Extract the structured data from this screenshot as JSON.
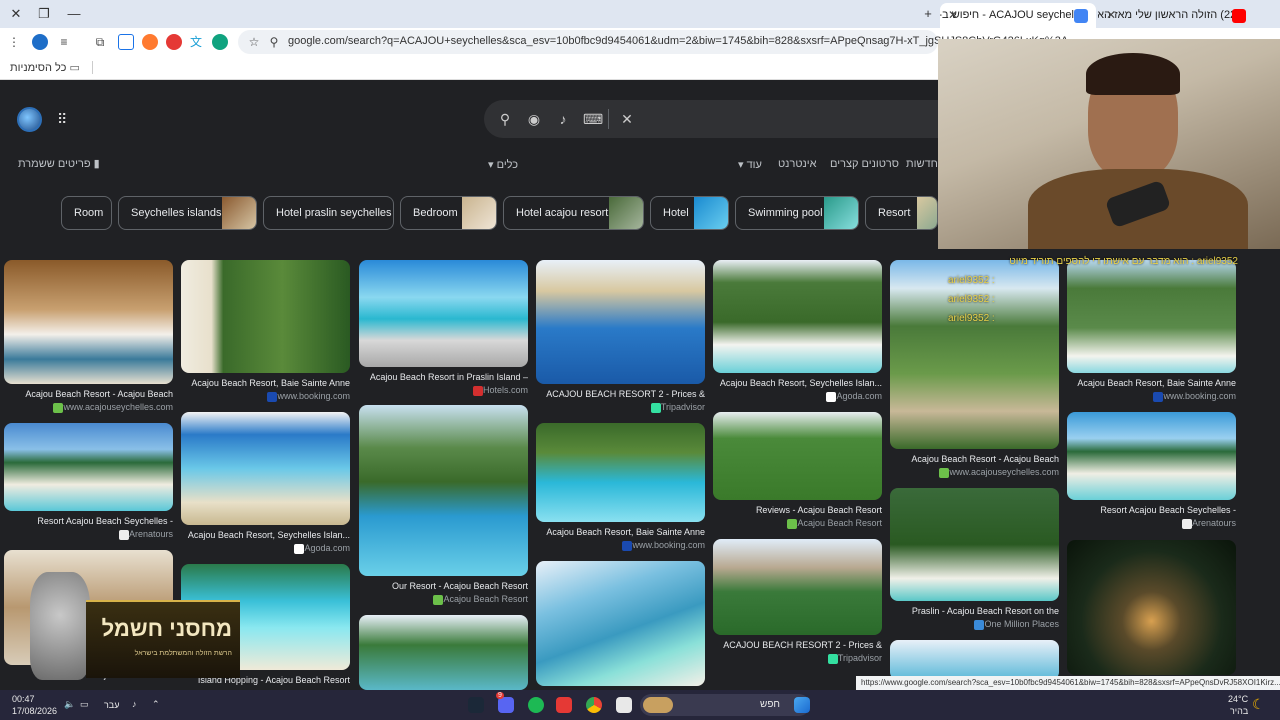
{
  "browser": {
    "tabs": [
      {
        "title": "ACAJOU seychelles - חיפוש ב-Google",
        "active": true
      },
      {
        "title": "(229) הזולה הראשון שלי מאז הא...",
        "active": false
      }
    ],
    "url": "google.com/search?q=ACAJOU+seychelles&sca_esv=10b0fbc9d9454061&udm=2&biw=1745&bih=828&sxsrf=APpeQnsag7H-xT_jgSUJS8CbVrG426LxKg%3A",
    "bookmarks_label": "כל הסימניות",
    "status_url": "https://www.google.com/search?sca_esv=10b0fbc9d9454061&biw=1745&bih=828&sxsrf=APpeQnsDvRJ58XOI1Kirz..."
  },
  "search": {
    "tools_left": "כלים",
    "saved_label": "פריטים ששמרת",
    "tools": [
      "חדשות",
      "סרטונים קצרים",
      "אינטרנט",
      "עוד"
    ]
  },
  "chips": [
    {
      "label": "Room"
    },
    {
      "label": "Seychelles islands"
    },
    {
      "label": "Hotel praslin seychelles"
    },
    {
      "label": "Bedroom"
    },
    {
      "label": "Hotel acajou resort"
    },
    {
      "label": "Hotel"
    },
    {
      "label": "Swimming pool"
    },
    {
      "label": "Resort"
    }
  ],
  "results": [
    {
      "caption": "Acajou Beach Resort - Acajou Beach",
      "source": "www.acajouseychelles.com"
    },
    {
      "caption": "Resort Acajou Beach Seychelles -",
      "source": "Arenatours"
    },
    {
      "caption": "Acajou Beach Resort",
      "source": "Hotels.com"
    },
    {
      "caption": "Acajou Beach Resort, Baie Sainte Anne",
      "source": "www.booking.com"
    },
    {
      "caption": "Acajou Beach Resort, Seychelles Islan...",
      "source": "Agoda.com"
    },
    {
      "caption": "Island Hopping - Acajou Beach Resort",
      "source": ""
    },
    {
      "caption": "Acajou Beach Resort in Praslin Island –",
      "source": "Hotels.com"
    },
    {
      "caption": "Our Resort - Acajou Beach Resort",
      "source": "Acajou Beach Resort"
    },
    {
      "caption": "ACAJOU BEACH RESORT 2 - Prices &",
      "source": "Tripadvisor"
    },
    {
      "caption": "Acajou Beach Resort, Baie Sainte Anne",
      "source": "www.booking.com"
    },
    {
      "caption": "Acajou Beach Resort, Seychelles Islan...",
      "source": "Agoda.com"
    },
    {
      "caption": "Reviews - Acajou Beach Resort",
      "source": "Acajou Beach Resort"
    },
    {
      "caption": "ACAJOU BEACH RESORT 2 - Prices &",
      "source": "Tripadvisor"
    },
    {
      "caption": "Acajou Beach Resort - Acajou Beach",
      "source": "www.acajouseychelles.com"
    },
    {
      "caption": "Praslin - Acajou Beach Resort on the",
      "source": "One Million Places"
    },
    {
      "caption": "Acajou Beach Resort, Baie Sainte Anne",
      "source": "www.booking.com"
    },
    {
      "caption": "Resort Acajou Beach Seychelles -",
      "source": "Arenatours"
    }
  ],
  "overlay": {
    "chat": [
      "ariel9352 : הוא מדבר עם אישתו די להספים תוריד מיוט",
      "ariel9352 :",
      "ariel9352 :",
      "ariel9352 :"
    ],
    "logo_title": "מחסני חשמל",
    "logo_subtitle": "הרשת הזולה והמשתלמת בישראל"
  },
  "taskbar": {
    "time": "00:47",
    "date": "17/08/2026",
    "lang": "עבר",
    "search_placeholder": "חפש",
    "weather_temp": "24°C",
    "weather_desc": "בהיר",
    "discord_badge": "9"
  }
}
